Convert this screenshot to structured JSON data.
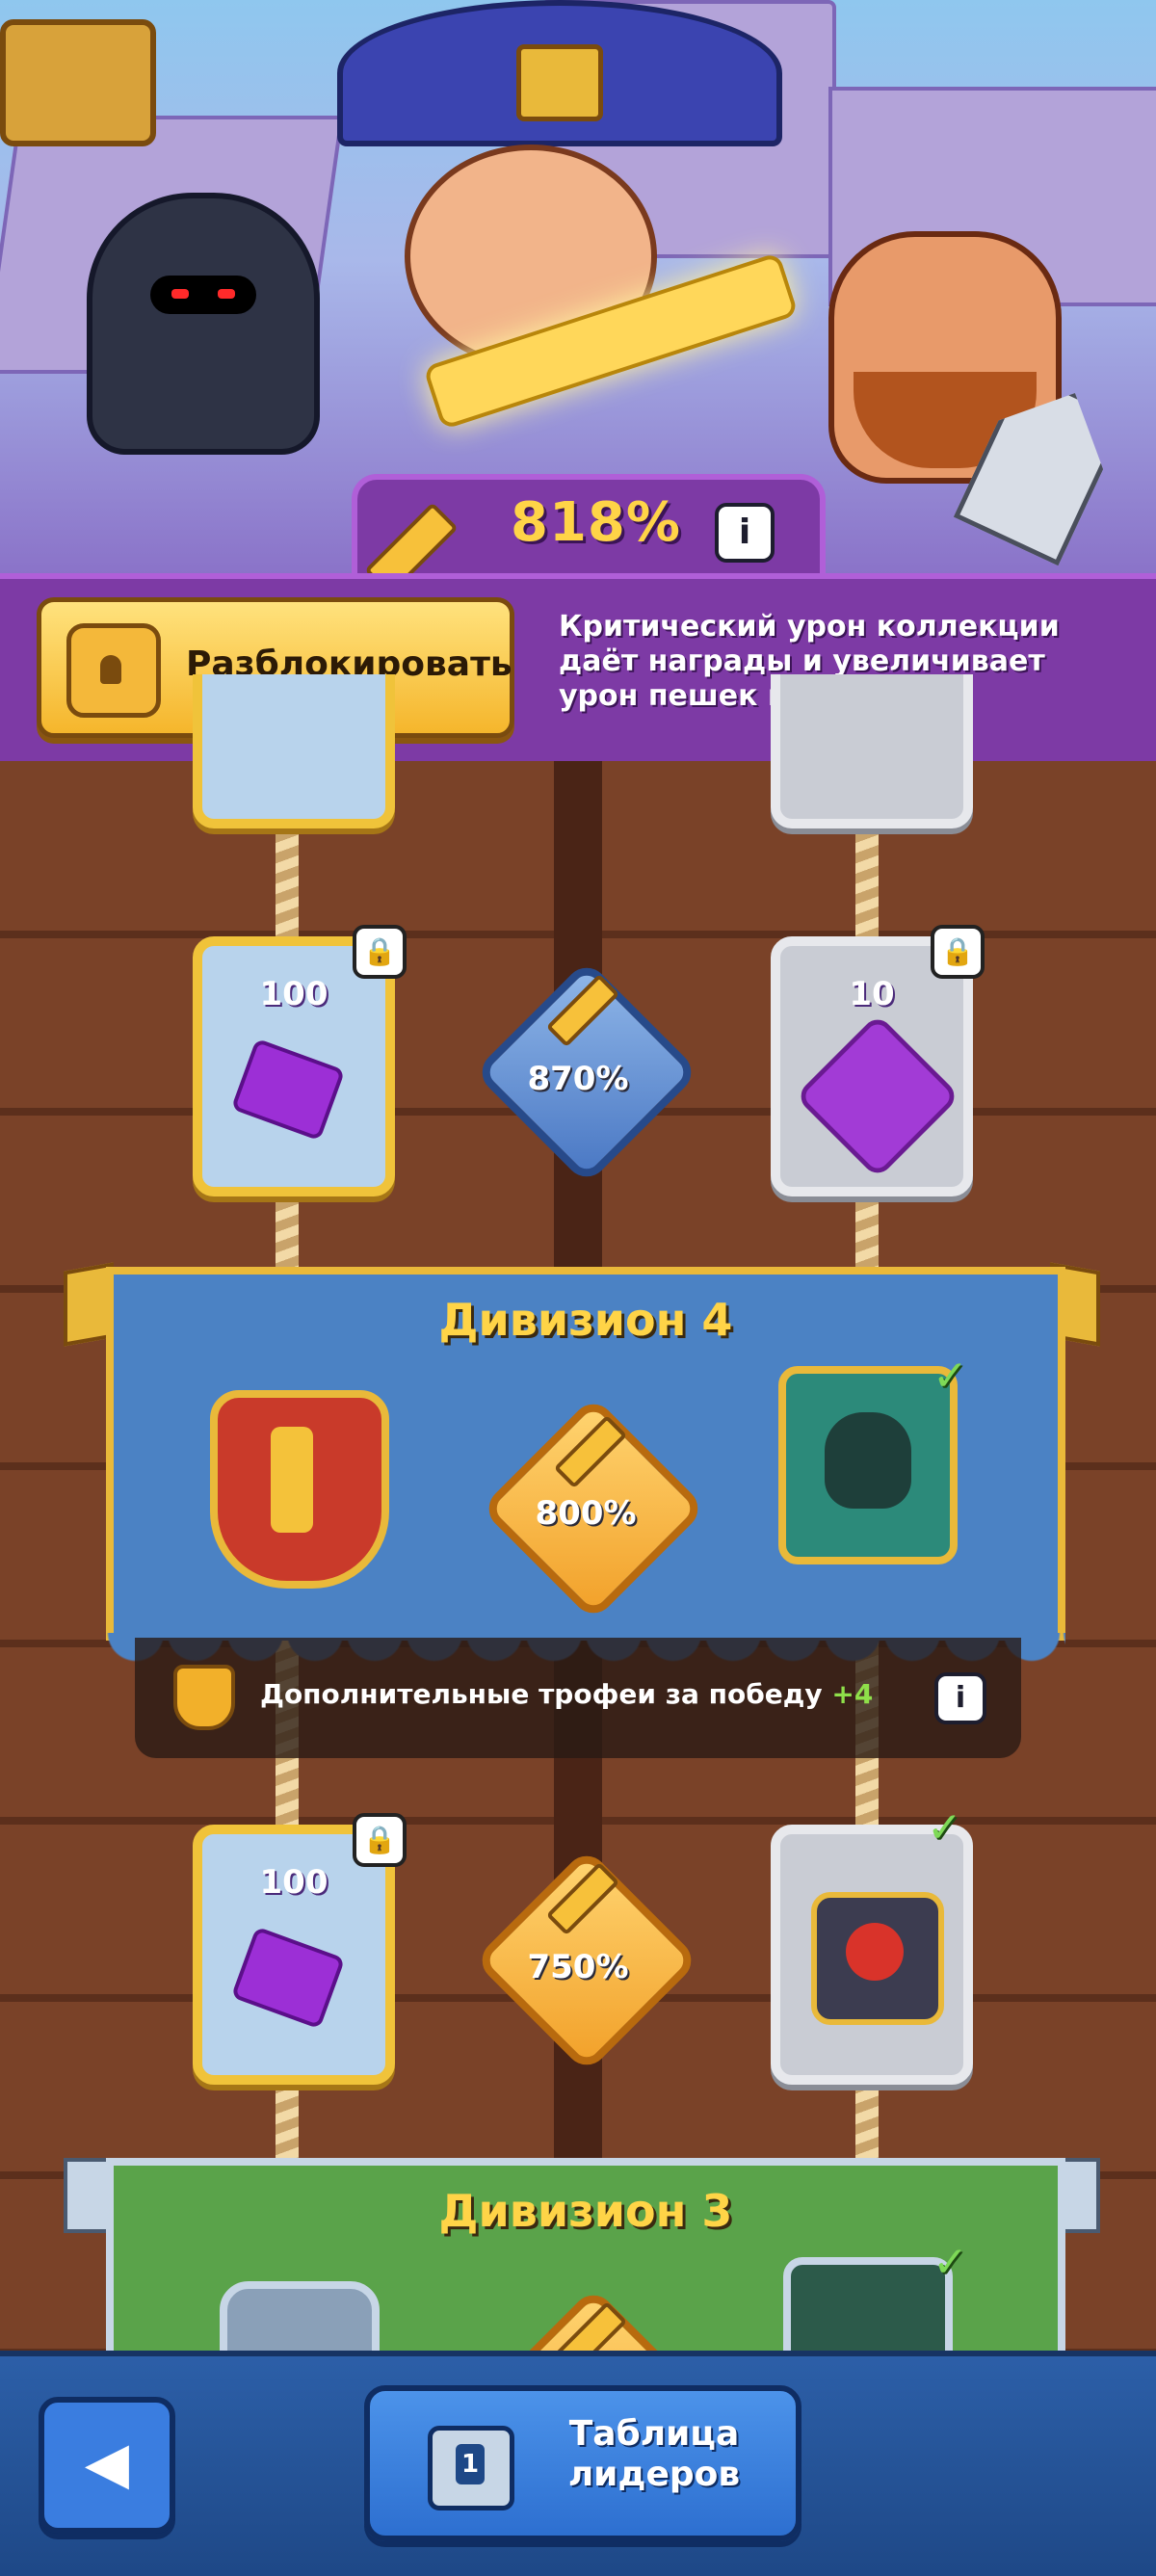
{
  "header": {
    "crit_value": "818%",
    "info_icon": "info-icon",
    "unlock_label": "Разблокировать",
    "description": "Критический урон коллекции даёт награды и увеличивает урон пешек в бою"
  },
  "track": {
    "row_top": {
      "left_card": {
        "amount": "100",
        "icon": "gem-icon",
        "locked": true
      },
      "center_bonus": "870%",
      "right_card": {
        "amount": "10",
        "icon": "hero-portrait-icon",
        "locked": true
      }
    },
    "division4": {
      "title": "Дивизион 4",
      "center_bonus": "800%",
      "trophy_text": "Дополнительные трофеи за победу",
      "trophy_bonus": "+4"
    },
    "row_bottom": {
      "left_card": {
        "amount": "100",
        "icon": "gem-icon",
        "locked": true
      },
      "center_bonus": "750%",
      "right_card": {
        "icon": "jester-icon",
        "claimed": true
      }
    },
    "division3": {
      "title": "Дивизион 3"
    }
  },
  "bottom_bar": {
    "back_icon": "back-arrow-icon",
    "leaderboard_label": "Таблица лидеров"
  },
  "colors": {
    "purple": "#7d3aa5",
    "gold": "#ffd447",
    "wood": "#7a4228",
    "blue": "#4b82c4",
    "green": "#5aa34a"
  }
}
